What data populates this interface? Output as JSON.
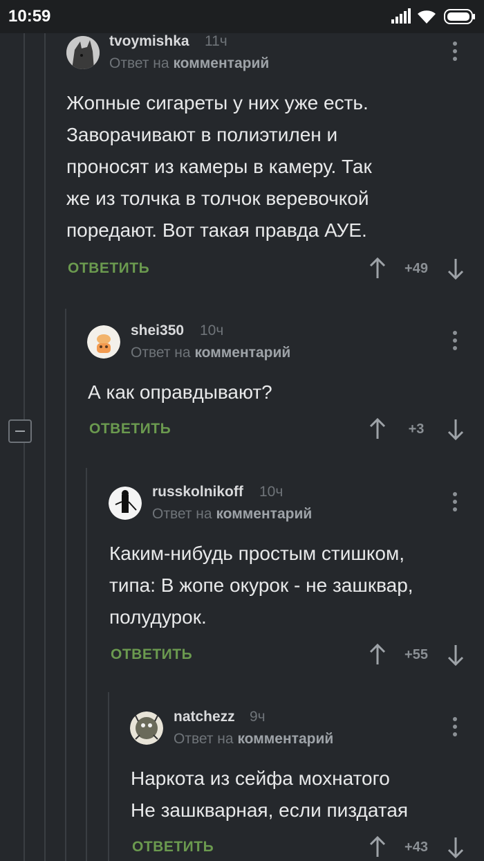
{
  "status": {
    "time": "10:59"
  },
  "comments": [
    {
      "username": "tvoymishka",
      "time": "11ч",
      "reply_prefix": "Ответ на",
      "reply_target": "комментарий",
      "text": "Жопные сигареты у них уже есть.\nЗаворачивают в полиэтилен и\nпроносят из камеры в камеру. Так\nже из толчка в толчок веревочкой\nпоредают. Вот такая правда АУЕ.",
      "reply_label": "ОТВЕТИТЬ",
      "score": "+49"
    },
    {
      "username": "shei350",
      "time": "10ч",
      "reply_prefix": "Ответ на",
      "reply_target": "комментарий",
      "text": "А как оправдывают?",
      "reply_label": "ОТВЕТИТЬ",
      "score": "+3"
    },
    {
      "username": "russkolnikoff",
      "time": "10ч",
      "reply_prefix": "Ответ на",
      "reply_target": "комментарий",
      "text": "Каким-нибудь простым стишком,\nтипа: В жопе окурок - не зашквар,\nполудурок.",
      "reply_label": "ОТВЕТИТЬ",
      "score": "+55"
    },
    {
      "username": "natchezz",
      "time": "9ч",
      "reply_prefix": "Ответ на",
      "reply_target": "комментарий",
      "text": "Наркота из сейфа мохнатого\nНе зашкварная, если пиздатая",
      "reply_label": "ОТВЕТИТЬ",
      "score": "+43"
    }
  ],
  "icons": {
    "signal": "signal-icon",
    "wifi": "wifi-icon",
    "battery": "battery-icon",
    "menu": "more-vert-icon",
    "up": "arrow-up-icon",
    "down": "arrow-down-icon",
    "collapse": "collapse-minus-icon"
  },
  "colors": {
    "background": "#25282c",
    "reply_green": "#6b9a4f",
    "muted": "#6f7479"
  }
}
